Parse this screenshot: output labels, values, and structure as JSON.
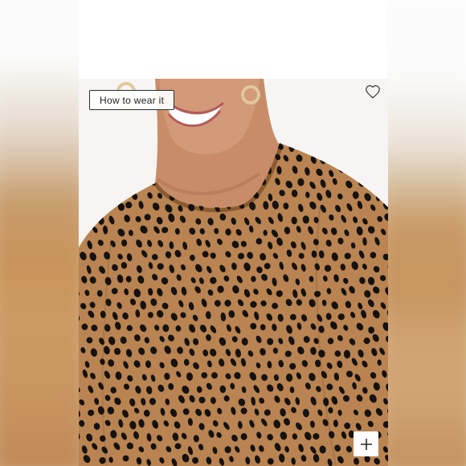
{
  "product_card": {
    "how_to_wear_label": "How to wear it",
    "icons": {
      "favorite": "heart-outline-icon",
      "expand": "plus-icon"
    },
    "colors": {
      "fabric_base": "#b98452",
      "spot_color": "#151210",
      "page_background": "#ffffff"
    }
  }
}
